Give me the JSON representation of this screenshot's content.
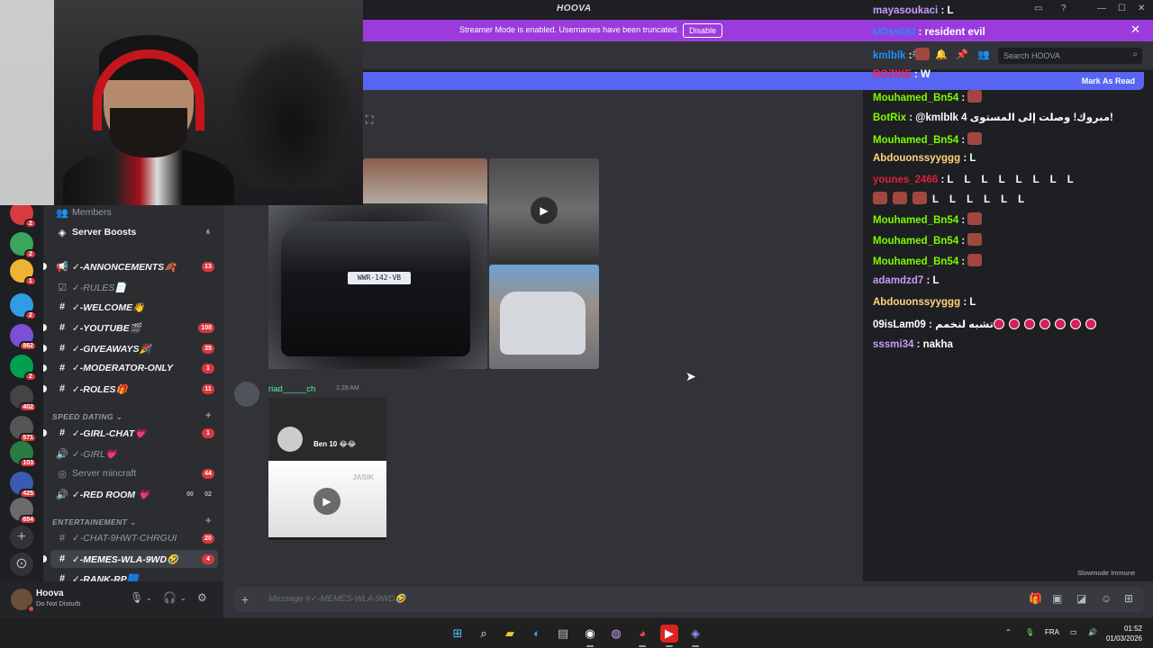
{
  "app": {
    "title": "HOOVA"
  },
  "banner": {
    "message": "Streamer Mode is enabled. Usernames have been truncated.",
    "disable_label": "Disable"
  },
  "header": {
    "search_placeholder": "Search HOOVA"
  },
  "new_messages": {
    "mark_read_label": "Mark As Read"
  },
  "servers": [
    {
      "badge": "2",
      "color": "#d83c3e"
    },
    {
      "badge": "2",
      "color": "#3ba55c"
    },
    {
      "badge": "1",
      "color": "#f0b232"
    },
    {
      "badge": "2",
      "color": "#2f9de4"
    },
    {
      "badge": "862",
      "color": "#7b4fd6"
    },
    {
      "badge": "2",
      "color": "#00a050"
    },
    {
      "badge": "402",
      "color": "#444444"
    },
    {
      "badge": "571",
      "color": "#555555"
    },
    {
      "badge": "103",
      "color": "#2a7a44"
    },
    {
      "badge": "425",
      "color": "#3a5bb0"
    },
    {
      "badge": "654",
      "color": "#6a6a6a"
    }
  ],
  "channels": {
    "members": "Members",
    "boosts": {
      "label": "Server Boosts",
      "count": "6"
    },
    "annonces": {
      "label": "✓-ANNONCEMENTS🍂",
      "count": "13"
    },
    "rules": {
      "label": "✓-RULES📄"
    },
    "welcome": {
      "label": "✓-WELCOME👋"
    },
    "youtube": {
      "label": "✓-YOUTUBE🎬",
      "count": "108"
    },
    "giveaways": {
      "label": "✓-GIVEAWAYS🎉",
      "count": "35"
    },
    "moderator": {
      "label": "✓-MODERATOR-ONLY",
      "count": "1"
    },
    "roles": {
      "label": "✓-ROLES🎁",
      "count": "11"
    },
    "cat_speed": "SPEED DATING",
    "girl_chat": {
      "label": "✓-GIRL-CHAT💗",
      "count": "1"
    },
    "girl": {
      "label": "✓-GIRL💗"
    },
    "mincraft": {
      "label": "Server mincraft",
      "count": "44"
    },
    "red_room": {
      "label": "✓-RED ROOM 💗",
      "count_a": "00",
      "count_b": "02"
    },
    "cat_ent": "ENTERTAINEMENT",
    "chat_9hwt": {
      "label": "✓-CHAT-9HWT-CHRGUI",
      "count": "20"
    },
    "memes": {
      "label": "✓-MEMES-WLA-9WD🤣",
      "count": "4"
    },
    "rank": {
      "label": "✓-RANK-RP🟦"
    }
  },
  "user": {
    "name": "Hoova",
    "status": "Do Not Disturb"
  },
  "chat": {
    "message2": {
      "author": "riad_____ch",
      "time": "1:28 AM",
      "video_caption": "Ben 10 😂😂",
      "watermark": "JASIK"
    },
    "plate": "WWR-142-VB"
  },
  "composer": {
    "placeholder": "Message #✓-MEMES-WLA-9WD🤣"
  },
  "stream_chat": [
    {
      "user": "mayasoukaci",
      "color": "#c79bff",
      "text": "",
      "emotes": "L"
    },
    {
      "user": "UOssOU",
      "color": "#1e90ff",
      "text": "resident evil"
    },
    {
      "user": "kmlblk",
      "color": "#1e90ff",
      "text": "",
      "emotes": "face"
    },
    {
      "user": "ROZIXE",
      "color": "#ff1f4b",
      "text": "",
      "emotes": "W"
    },
    {
      "user": "Mouhamed_Bn54",
      "color": "#7cfc00",
      "text": "",
      "emotes": "face"
    },
    {
      "user": "BotRix",
      "color": "#7cfc00",
      "text": "@kmlblk 4 مبروك! وصلت إلى المستوى!"
    },
    {
      "user": "Mouhamed_Bn54",
      "color": "#7cfc00",
      "text": "",
      "emotes": "face"
    },
    {
      "user": "Abdouonssyyggg",
      "color": "#ffd27f",
      "text": "",
      "emotes": "L"
    },
    {
      "user": "younes_2466",
      "color": "#e0203b",
      "text": "",
      "emotes": "L L L L L L L L"
    },
    {
      "user": "",
      "color": "#ffffff",
      "text": "",
      "emotes": "faces L L L L L L"
    },
    {
      "user": "Mouhamed_Bn54",
      "color": "#7cfc00",
      "text": "",
      "emotes": "face"
    },
    {
      "user": "Mouhamed_Bn54",
      "color": "#7cfc00",
      "text": "",
      "emotes": "face"
    },
    {
      "user": "Mouhamed_Bn54",
      "color": "#7cfc00",
      "text": "",
      "emotes": "face"
    },
    {
      "user": "adamdzd7",
      "color": "#c79bff",
      "text": "",
      "emotes": "L"
    },
    {
      "user": "Abdouonssyyggg",
      "color": "#ffd27f",
      "text": "",
      "emotes": "L"
    },
    {
      "user": "09isLam09",
      "color": "#ffffff",
      "text": "تشبه لنخمم",
      "emotes": "dots"
    },
    {
      "user": "sssmi34",
      "color": "#c79bff",
      "text": "nakha"
    }
  ],
  "slowmode": "Slowmode Immune",
  "taskbar": {
    "lang": "FRA",
    "time": "01:52",
    "date": "01/03/2026"
  },
  "colors": {
    "accent": "#5865f2",
    "banner": "#9b3bdc",
    "badge": "#da373c"
  }
}
